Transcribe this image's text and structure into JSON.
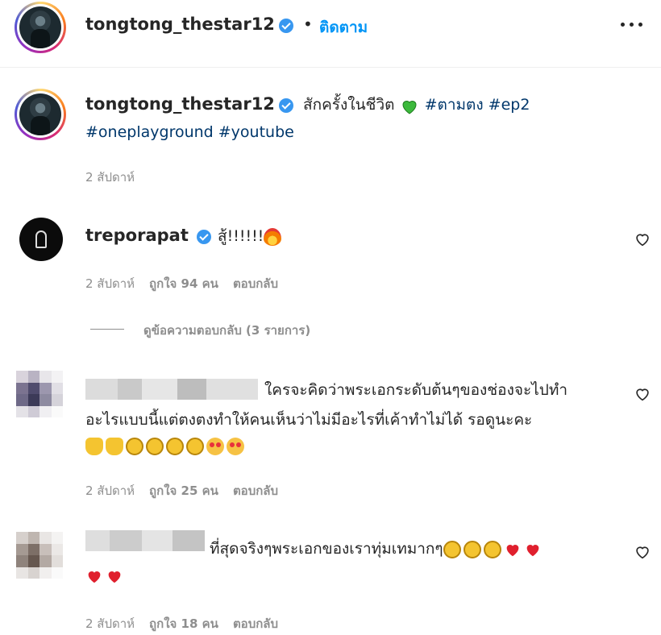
{
  "header": {
    "username": "tongtong_thestar12",
    "separator": "•",
    "follow_label": "ติดตาม"
  },
  "caption": {
    "username": "tongtong_thestar12",
    "text": "สักครั้งในชีวิต",
    "tags_line1": "#ตามตง #ep2",
    "tags_line2": "#oneplayground #youtube",
    "time": "2 สัปดาห์"
  },
  "comments": [
    {
      "username": "treporapat",
      "text": "สู้!!!!!!",
      "time": "2 สัปดาห์",
      "likes": "ถูกใจ 94 คน",
      "reply_label": "ตอบกลับ"
    },
    {
      "text_line1": "ใครจะคิดว่าพระเอกระดับต้นๆของช่องจะไปทำ",
      "text_line2": "อะไรแบบนี้แต่ตงตงทำให้คนเห็นว่าไม่มีอะไรที่เค้าทำไม่ได้ รอดูนะคะ",
      "time": "2 สัปดาห์",
      "likes": "ถูกใจ 25 คน",
      "reply_label": "ตอบกลับ"
    },
    {
      "text_line1": "ที่สุดจริงๆพระเอกของเราทุ่มเทมากๆ",
      "time": "2 สัปดาห์",
      "likes": "ถูกใจ 18 คน",
      "reply_label": "ตอบกลับ"
    }
  ],
  "view_replies": "ดูข้อความตอบกลับ (3 รายการ)",
  "icons": {
    "more": "more-horizontal-icon",
    "heart": "heart-outline-icon",
    "verified": "verified-badge-icon"
  },
  "colors": {
    "link_blue": "#0095f6",
    "hashtag": "#00376b",
    "meta_gray": "#8e8e8e",
    "verified": "#3897f0"
  }
}
